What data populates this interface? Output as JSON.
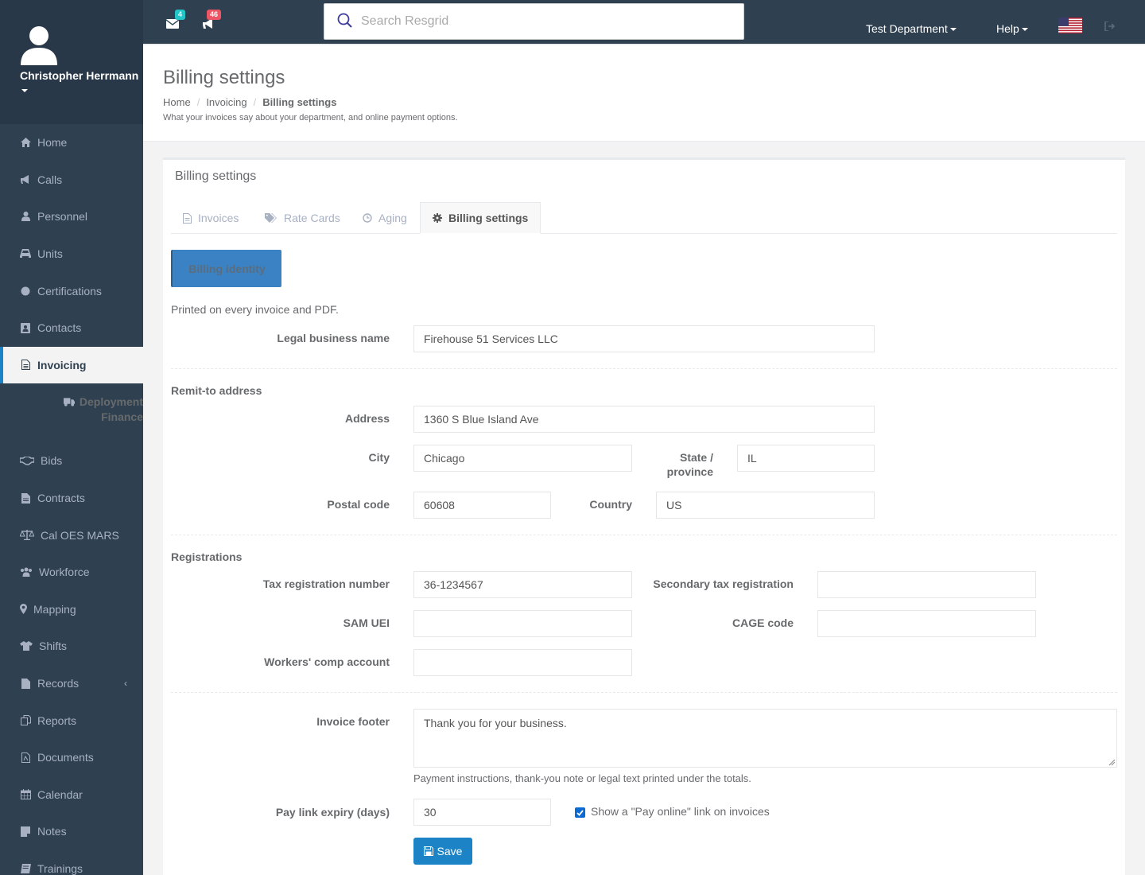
{
  "user": {
    "name": "Christopher Herrmann"
  },
  "sidebar": {
    "items": [
      {
        "label": "Home",
        "icon": "home-icon"
      },
      {
        "label": "Calls",
        "icon": "bullhorn-icon"
      },
      {
        "label": "Personnel",
        "icon": "user-icon"
      },
      {
        "label": "Units",
        "icon": "truck-icon"
      },
      {
        "label": "Certifications",
        "icon": "certificate-icon"
      },
      {
        "label": "Contacts",
        "icon": "address-book-icon"
      },
      {
        "label": "Invoicing",
        "icon": "file-text-icon"
      },
      {
        "label": "Deployment Finance",
        "icon": "truck-icon"
      },
      {
        "label": "Bids",
        "icon": "handshake-icon"
      },
      {
        "label": "Contracts",
        "icon": "file-icon"
      },
      {
        "label": "Cal OES MARS",
        "icon": "balance-scale-icon"
      },
      {
        "label": "Workforce",
        "icon": "users-icon"
      },
      {
        "label": "Mapping",
        "icon": "map-marker-icon"
      },
      {
        "label": "Shifts",
        "icon": "shirt-icon"
      },
      {
        "label": "Records",
        "icon": "file-icon"
      },
      {
        "label": "Reports",
        "icon": "copy-icon"
      },
      {
        "label": "Documents",
        "icon": "file-pdf-icon"
      },
      {
        "label": "Calendar",
        "icon": "calendar-icon"
      },
      {
        "label": "Notes",
        "icon": "sticky-note-icon"
      },
      {
        "label": "Trainings",
        "icon": "book-icon"
      }
    ]
  },
  "topbar": {
    "messages_count": "4",
    "calls_count": "46",
    "search_placeholder": "Search Resgrid",
    "department": "Test Department",
    "help": "Help"
  },
  "heading": {
    "title": "Billing settings",
    "breadcrumb": [
      "Home",
      "Invoicing",
      "Billing settings"
    ],
    "subtitle": "What your invoices say about your department, and online payment options."
  },
  "card": {
    "title": "Billing settings",
    "tabs": [
      "Invoices",
      "Rate Cards",
      "Aging",
      "Billing settings"
    ],
    "identity_button": "Billing identity",
    "identity_help": "Printed on every invoice and PDF."
  },
  "form": {
    "legal_business_name": {
      "label": "Legal business name",
      "value": "Firehouse 51 Services LLC"
    },
    "remit_title": "Remit-to address",
    "address": {
      "label": "Address",
      "value": "1360 S Blue Island Ave"
    },
    "city": {
      "label": "City",
      "value": "Chicago"
    },
    "state": {
      "label_line1": "State /",
      "label_line2": "province",
      "value": "IL"
    },
    "postal_code": {
      "label": "Postal code",
      "value": "60608"
    },
    "country": {
      "label": "Country",
      "value": "US"
    },
    "registrations_title": "Registrations",
    "tax_registration": {
      "label": "Tax registration number",
      "value": "36-1234567"
    },
    "secondary_tax": {
      "label": "Secondary tax registration",
      "value": ""
    },
    "sam_uei": {
      "label": "SAM UEI",
      "value": ""
    },
    "cage_code": {
      "label": "CAGE code",
      "value": ""
    },
    "workers_comp": {
      "label": "Workers' comp account",
      "value": ""
    },
    "invoice_footer": {
      "label": "Invoice footer",
      "value": "Thank you for your business.",
      "help": "Payment instructions, thank-you note or legal text printed under the totals."
    },
    "pay_link_expiry": {
      "label": "Pay link expiry (days)",
      "value": "30"
    },
    "pay_online": {
      "label": "Show a \"Pay online\" link on invoices",
      "checked": true
    },
    "save_label": "Save"
  }
}
